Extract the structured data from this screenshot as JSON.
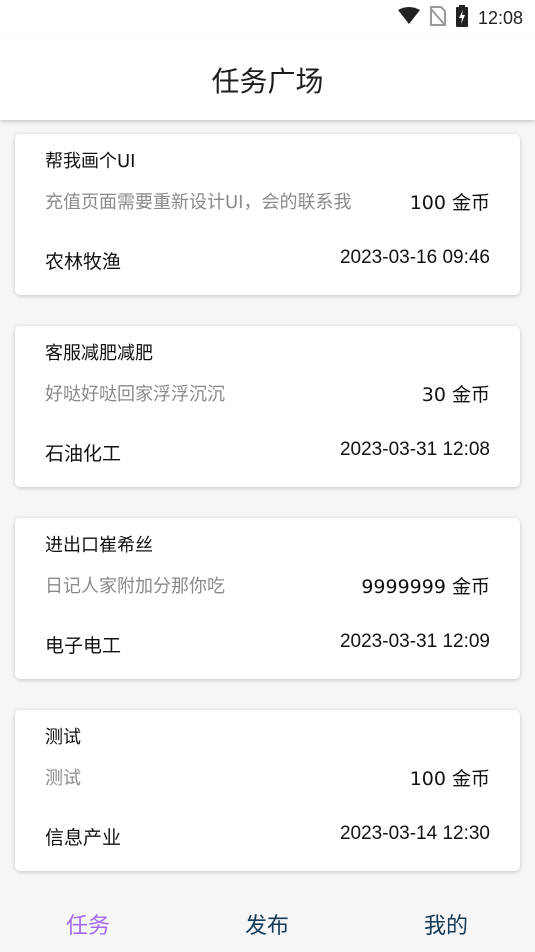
{
  "status_bar": {
    "time": "12:08",
    "icons": [
      "wifi-icon",
      "no-sim-icon",
      "battery-charging-icon"
    ]
  },
  "header": {
    "title": "任务广场"
  },
  "tasks": [
    {
      "title": "帮我画个UI",
      "description": "充值页面需要重新设计UI，会的联系我",
      "reward": "100 金币",
      "category": "农林牧渔",
      "time": "2023-03-16 09:46"
    },
    {
      "title": "客服减肥减肥",
      "description": "好哒好哒回家浮浮沉沉",
      "reward": "30 金币",
      "category": "石油化工",
      "time": "2023-03-31 12:08"
    },
    {
      "title": "进出口崔希丝",
      "description": "日记人家附加分那你吃",
      "reward": "9999999 金币",
      "category": "电子电工",
      "time": "2023-03-31 12:09"
    },
    {
      "title": "测试",
      "description": "测试",
      "reward": "100 金币",
      "category": "信息产业",
      "time": "2023-03-14 12:30"
    }
  ],
  "bottom_nav": {
    "items": [
      {
        "label": "任务",
        "color": "#a56af0",
        "active": true
      },
      {
        "label": "发布",
        "color": "#123b5a",
        "active": false
      },
      {
        "label": "我的",
        "color": "#123b5a",
        "active": false
      }
    ]
  }
}
